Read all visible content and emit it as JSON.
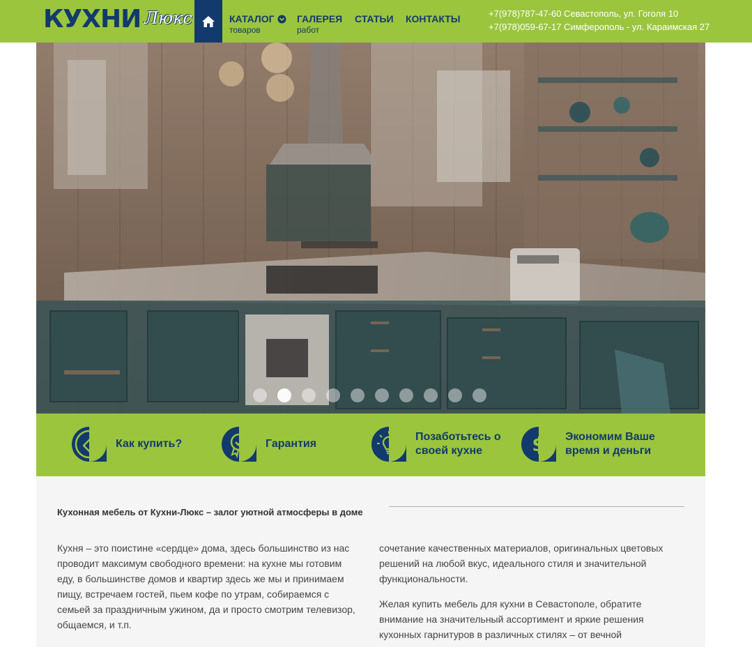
{
  "header": {
    "logo_main": "КУХНИ",
    "logo_script": "Люкс",
    "nav": [
      {
        "label": "КАТАЛОГ",
        "sub": "товаров"
      },
      {
        "label": "ГАЛЕРЕЯ",
        "sub": "работ"
      },
      {
        "label": "СТАТЬИ",
        "sub": ""
      },
      {
        "label": "КОНТАКТЫ",
        "sub": ""
      }
    ],
    "contacts": [
      "+7(978)787-47-60 Севастополь, ул. Гоголя 10",
      "+7(978)059-67-17 Симферополь - ул. Караимская 27"
    ]
  },
  "slider": {
    "slide_count": 10,
    "active_slide": 2
  },
  "features": [
    {
      "label": "Как купить?",
      "icon": "tag-icon"
    },
    {
      "label": "Гарантия",
      "icon": "award-icon"
    },
    {
      "label": "Позаботьтесь о своей кухне",
      "icon": "lightbulb-icon"
    },
    {
      "label": "Экономим Ваше время и деньги",
      "icon": "dollar-icon"
    }
  ],
  "content": {
    "title": "Кухонная мебель от Кухни-Люкс – залог уютной атмосферы в доме",
    "left_paragraph": "Кухня – это поистине «сердце» дома, здесь большинство из нас проводит максимум свободного времени: на кухне мы готовим еду, в большинстве домов и квартир здесь же мы и принимаем пищу, встречаем гостей, пьем кофе по утрам, собираемся с семьей за праздничным ужином, да и просто смотрим телевизор, общаемся, и т.п.",
    "right_paragraph_1": "сочетание качественных материалов, оригинальных цветовых решений на любой вкус, идеального стиля и значительной функциональности.",
    "right_paragraph_2": "Желая купить мебель для кухни в Севастополе, обратите внимание на значительный ассортимент и яркие решения кухонных гарнитуров в различных стилях – от вечной"
  },
  "colors": {
    "brand_green": "#9bc53d",
    "brand_navy": "#133a6c",
    "content_bg": "#f5f5f5"
  }
}
